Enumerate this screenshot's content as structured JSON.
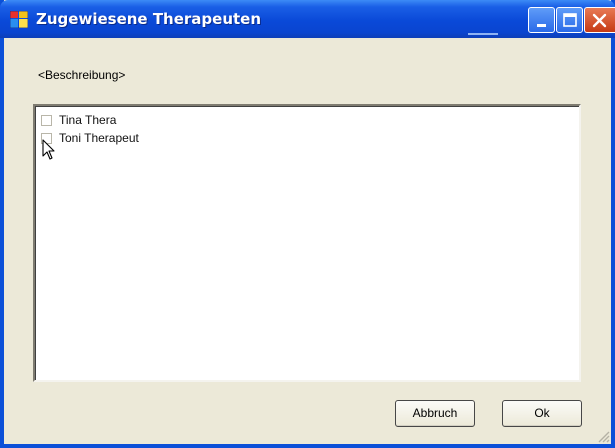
{
  "window": {
    "title": "Zugewiesene Therapeuten",
    "description": "<Beschreibung>"
  },
  "list": {
    "items": [
      {
        "label": "Tina Thera",
        "checked": false
      },
      {
        "label": "Toni Therapeut",
        "checked": false
      }
    ]
  },
  "buttons": {
    "cancel_label": "Abbruch",
    "ok_label": "Ok"
  },
  "icons": {
    "app": "app-icon",
    "minimize": "minimize-icon",
    "maximize": "maximize-icon",
    "close": "close-icon",
    "cursor": "mouse-pointer-icon"
  },
  "colors": {
    "titlebar": "#0a49d8",
    "window_bg": "#ece9d8",
    "close_button": "#c63a14"
  }
}
